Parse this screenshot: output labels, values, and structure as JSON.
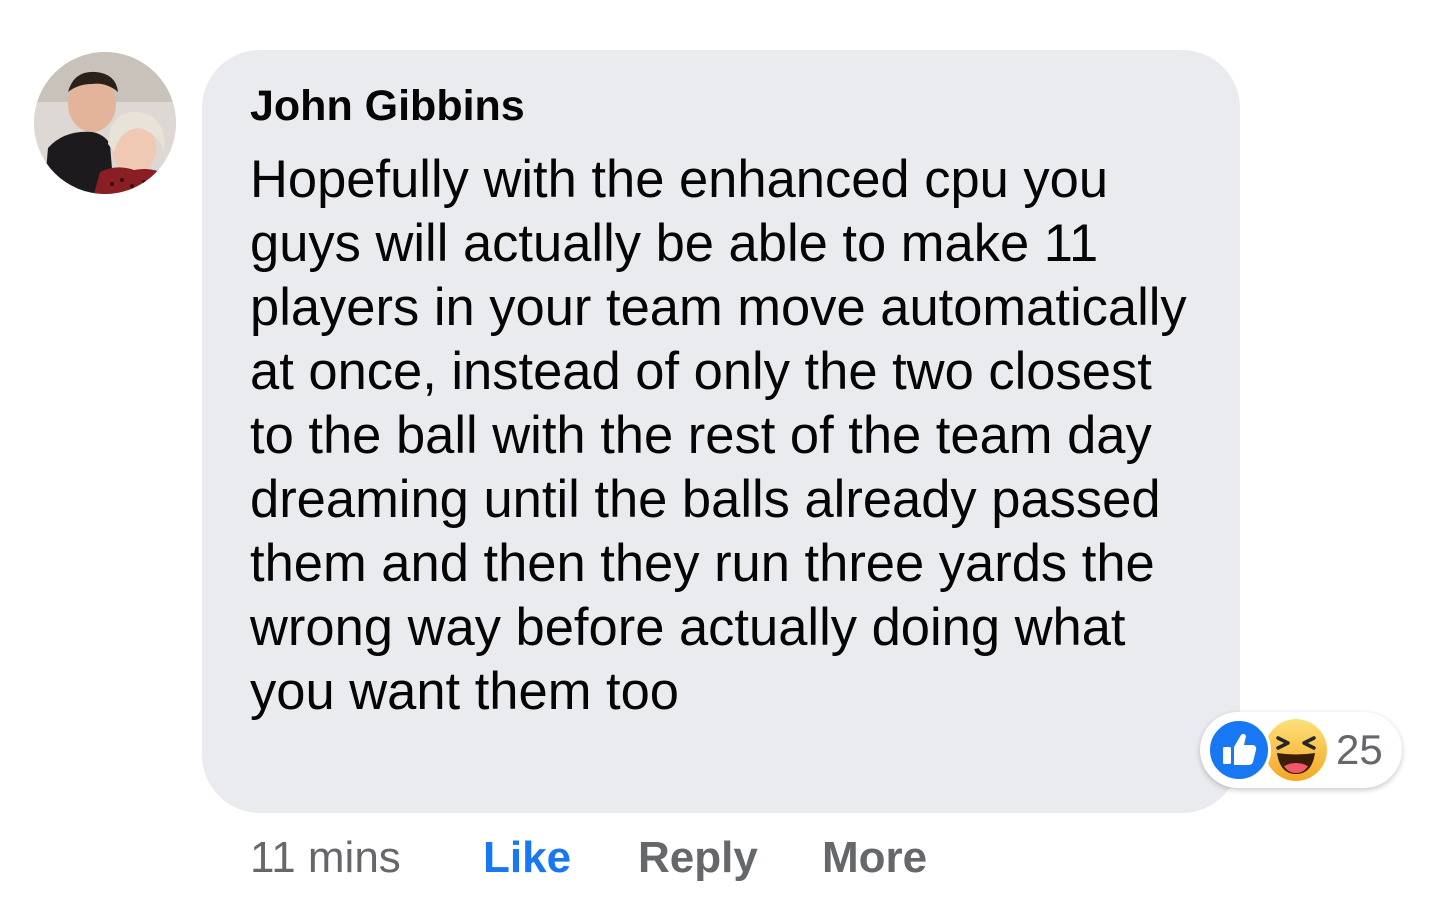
{
  "comment": {
    "author": "John Gibbins",
    "text": "Hopefully with the enhanced cpu you guys will actually be able to make 11 players in your team move automatically at once, instead of only the two closest to the ball with the rest of the team day dreaming until the balls already passed them and then they run three yards the wrong way before actually doing what you want them too",
    "avatar_icon": "profile-photo"
  },
  "reactions": {
    "icons": [
      "like-reaction-icon",
      "haha-reaction-icon"
    ],
    "count": "25",
    "like_color": "#1877f2",
    "haha_color": "#f7b125"
  },
  "actions": {
    "time": "11 mins",
    "like": "Like",
    "reply": "Reply",
    "more": "More"
  },
  "colors": {
    "bubble": "#eaebef",
    "text": "#050505",
    "muted": "#65676b",
    "accent": "#1877f2"
  }
}
